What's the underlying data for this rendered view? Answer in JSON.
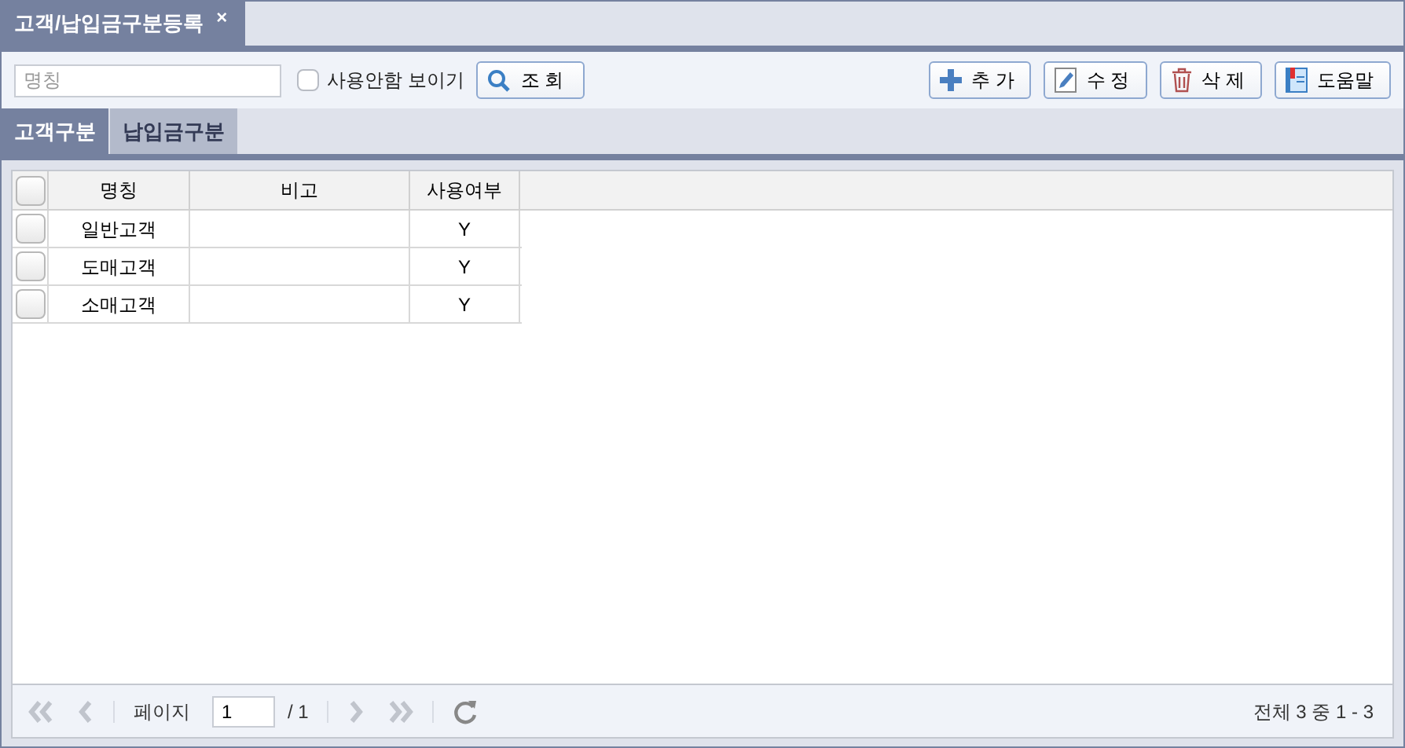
{
  "window": {
    "tab_title": "고객/납입금구분등록",
    "close": "×"
  },
  "toolbar": {
    "search": {
      "placeholder": "명칭"
    },
    "show_unused": {
      "label": "사용안함 보이기",
      "checked": false
    },
    "search_button": "조 회",
    "buttons": [
      {
        "kind": "add",
        "label": "추 가"
      },
      {
        "kind": "edit",
        "label": "수 정"
      },
      {
        "kind": "delete",
        "label": "삭 제"
      },
      {
        "kind": "help",
        "label": "도움말"
      }
    ]
  },
  "tabs": [
    {
      "label": "고객구분",
      "selected": true
    },
    {
      "label": "납입금구분",
      "selected": false
    }
  ],
  "table": {
    "columns": [
      "명칭",
      "비고",
      "사용여부"
    ],
    "header_checked": false,
    "rows": [
      {
        "checked": false,
        "name": "일반고객",
        "use": "Y"
      },
      {
        "checked": false,
        "name": "도매고객",
        "use": "Y"
      },
      {
        "checked": false,
        "name": "소매고객",
        "use": "Y"
      }
    ]
  },
  "pager": {
    "label": "페이지",
    "page": "1",
    "total_pages": "/ 1",
    "summary": "전체 3 중 1 - 3"
  }
}
